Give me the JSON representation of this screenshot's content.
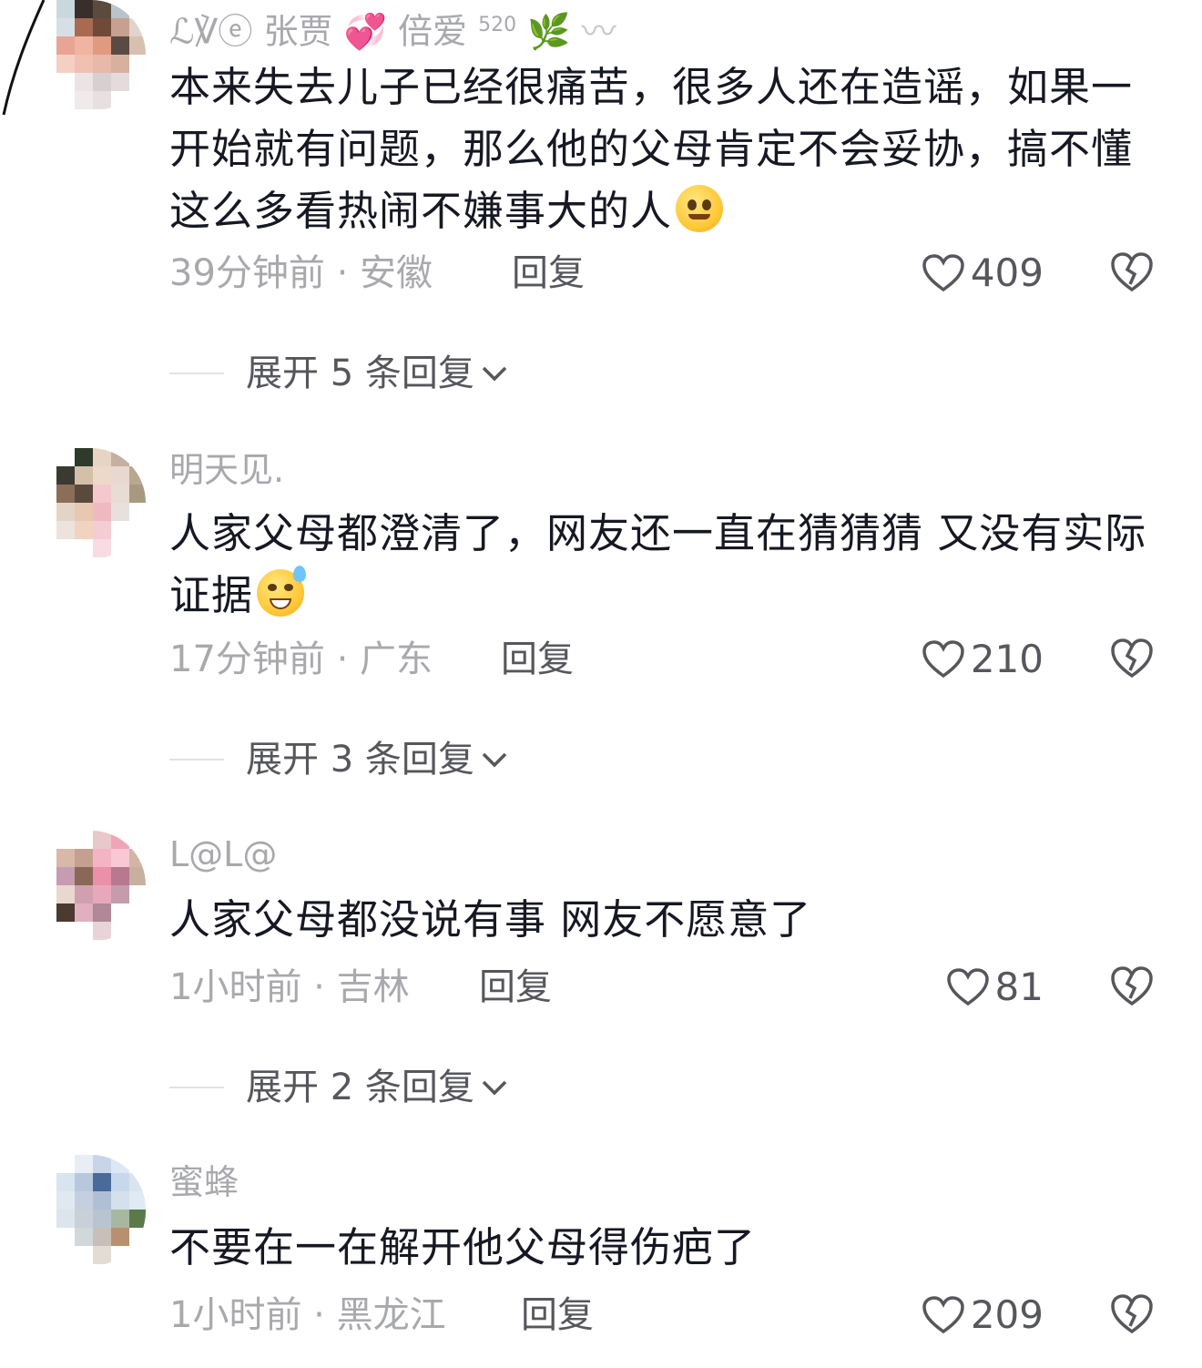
{
  "comments": [
    {
      "username": "ℒ℣ⓔ 张贾",
      "username_suffix": "倍爱",
      "badge": "520",
      "text": "本来失去儿子已经很痛苦，很多人还在造谣，如果一开始就有问题，那么他的父母肯定不会妥协，搞不懂这么多看热闹不嫌事大的人",
      "emoji": "pleading-face-emoji",
      "time_location": "39分钟前 · 安徽",
      "reply_label": "回复",
      "likes": "409",
      "expand_label": "展开 5 条回复"
    },
    {
      "username": "明天见.",
      "text": "人家父母都澄清了，网友还一直在猜猜猜 又没有实际证据",
      "emoji": "grinning-sweat-emoji",
      "time_location": "17分钟前 · 广东",
      "reply_label": "回复",
      "likes": "210",
      "expand_label": "展开 3 条回复"
    },
    {
      "username": "L@L@",
      "text": "人家父母都没说有事 网友不愿意了",
      "time_location": "1小时前 · 吉林",
      "reply_label": "回复",
      "likes": "81",
      "expand_label": "展开 2 条回复"
    },
    {
      "username": "蜜蜂",
      "text": "不要在一在解开他父母得伤疤了",
      "time_location": "1小时前 · 黑龙江",
      "reply_label": "回复",
      "likes": "209"
    }
  ],
  "colors": {
    "text_primary": "#161823",
    "text_secondary": "#a8a9ad",
    "text_action": "#56575c",
    "divider": "#e3e3e4"
  }
}
